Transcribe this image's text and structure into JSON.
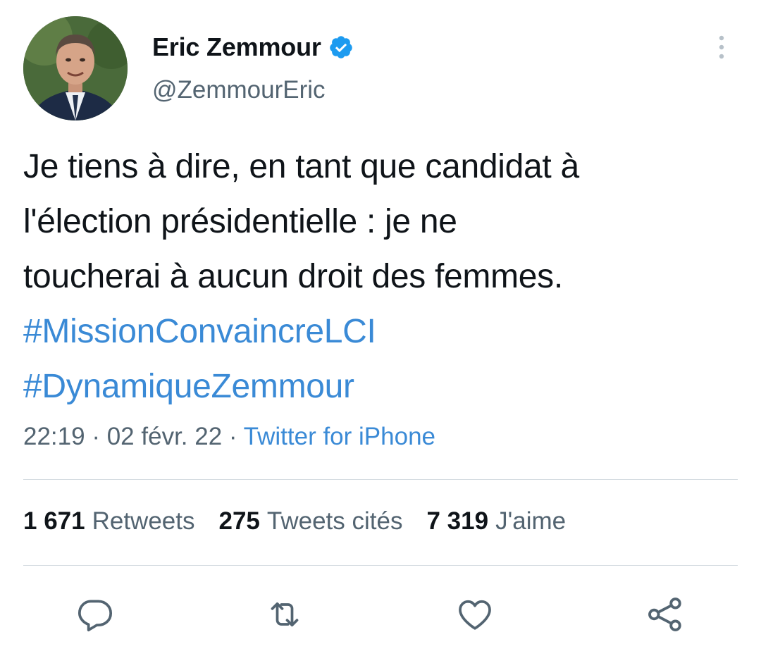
{
  "author": {
    "display_name": "Eric Zemmour",
    "handle": "@ZemmourEric",
    "verified": true
  },
  "tweet": {
    "text_lines": [
      "Je tiens à dire, en tant que candidat à",
      "l'élection présidentielle : je ne",
      "toucherai à aucun droit des femmes."
    ],
    "hashtags": [
      "#MissionConvaincreLCI",
      "#DynamiqueZemmour"
    ],
    "time": "22:19",
    "date": "02 févr. 22",
    "separator": "·",
    "source": "Twitter for iPhone"
  },
  "stats": {
    "retweets_count": "1 671",
    "retweets_label": "Retweets",
    "quotes_count": "275",
    "quotes_label": "Tweets cités",
    "likes_count": "7 319",
    "likes_label": "J'aime"
  },
  "actions": {
    "reply_icon": "reply-icon",
    "retweet_icon": "retweet-icon",
    "like_icon": "heart-icon",
    "share_icon": "share-icon"
  },
  "colors": {
    "text": "#0f1419",
    "secondary": "#536471",
    "link": "#3a8ad6",
    "verified": "#1d9bf0",
    "divider": "#d6dde2"
  }
}
